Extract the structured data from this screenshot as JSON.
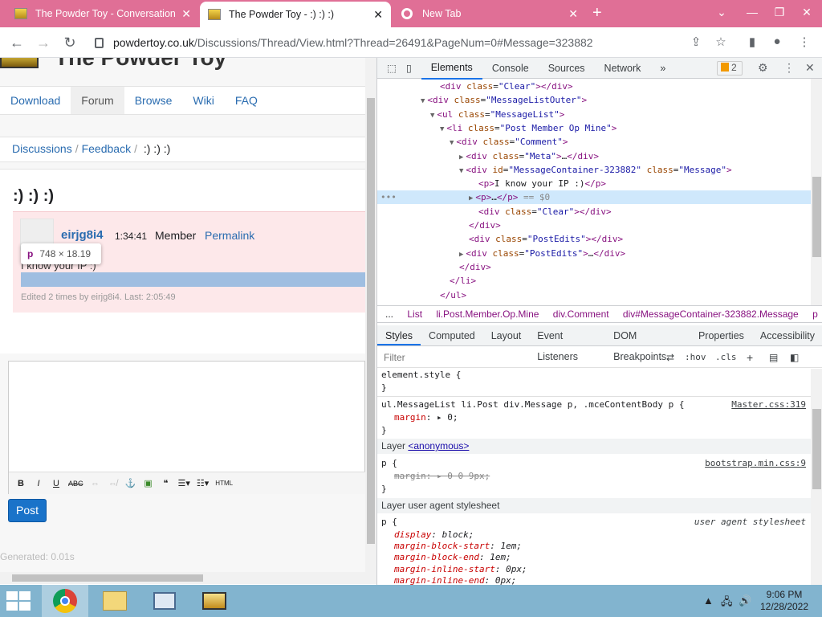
{
  "browser": {
    "tabs": [
      {
        "title": "The Powder Toy - Conversation",
        "icon": "powder-toy-favicon"
      },
      {
        "title": "The Powder Toy - :) :) :)",
        "icon": "powder-toy-favicon",
        "active": true
      },
      {
        "title": "New Tab",
        "icon": "chrome-icon"
      }
    ],
    "url_host": "powdertoy.co.uk",
    "url_path": "/Discussions/Thread/View.html?Thread=26491&PageNum=0#Message=323882"
  },
  "site": {
    "title": "The Powder Toy",
    "menu": [
      "Download",
      "Forum",
      "Browse",
      "Wiki",
      "FAQ"
    ],
    "menu_current": "Forum",
    "breadcrumb": [
      "Discussions",
      "Feedback",
      ":) :) :)"
    ],
    "thread_title": ":) :) :)",
    "post": {
      "author": "eirjg8i4",
      "time": "1:34:41",
      "rank": "Member",
      "permalink": "Permalink",
      "message": "I know your IP :)",
      "edits": "Edited 2 times by eirjg8i4. Last: 2:05:49"
    },
    "tooltip": {
      "tag": "p",
      "size": "748 × 18.19"
    },
    "editor_toolbar": [
      "B",
      "I",
      "U",
      "ABC",
      "⇔",
      "⇎",
      "⚓",
      "▣",
      "❝",
      "☰▾",
      "☷▾",
      "HTML"
    ],
    "post_button": "Post",
    "generated": "Generated: 0.01s"
  },
  "devtools": {
    "tabs": [
      "Elements",
      "Console",
      "Sources",
      "Network",
      "»"
    ],
    "active_tab": "Elements",
    "issues_count": "2",
    "dom_lines": [
      {
        "indent": 6,
        "arrow": "",
        "html": "<div class=\"Clear\"></div>"
      },
      {
        "indent": 5,
        "arrow": "▼",
        "html": "<div class=\"MessageListOuter\">"
      },
      {
        "indent": 6,
        "arrow": "▼",
        "html": "<ul class=\"MessageList\">"
      },
      {
        "indent": 7,
        "arrow": "▼",
        "html": "<li class=\"Post Member Op Mine\">"
      },
      {
        "indent": 8,
        "arrow": "▼",
        "html": "<div class=\"Comment\">"
      },
      {
        "indent": 9,
        "arrow": "▶",
        "html": "<div class=\"Meta\">…</div>"
      },
      {
        "indent": 9,
        "arrow": "▼",
        "html": "<div id=\"MessageContainer-323882\" class=\"Message\">"
      },
      {
        "indent": 10,
        "arrow": "",
        "html": "<p>I know your IP :)</p>"
      },
      {
        "indent": 10,
        "arrow": "▶",
        "html": "<p>…</p> == $0",
        "selected": true
      },
      {
        "indent": 10,
        "arrow": "",
        "html": "<div class=\"Clear\"></div>"
      },
      {
        "indent": 9,
        "arrow": "",
        "html": "</div>"
      },
      {
        "indent": 9,
        "arrow": "",
        "html": "<div class=\"PostEdits\"></div>"
      },
      {
        "indent": 9,
        "arrow": "▶",
        "html": "<div class=\"PostEdits\">…</div>"
      },
      {
        "indent": 8,
        "arrow": "",
        "html": "</div>"
      },
      {
        "indent": 7,
        "arrow": "",
        "html": "</li>"
      },
      {
        "indent": 6,
        "arrow": "",
        "html": "</ul>"
      }
    ],
    "breadcrumb": [
      "...",
      "List",
      "li.Post.Member.Op.Mine",
      "div.Comment",
      "div#MessageContainer-323882.Message",
      "p"
    ],
    "style_tabs": [
      "Styles",
      "Computed",
      "Layout",
      "Event Listeners",
      "DOM Breakpoints",
      "Properties",
      "Accessibility"
    ],
    "filter_placeholder": "Filter",
    "hov": ":hov",
    "cls": ".cls",
    "rules": {
      "element_style": "element.style {",
      "close": "}",
      "rule1_selector": "ul.MessageList li.Post div.Message p, .mceContentBody p {",
      "rule1_source": "Master.css:319",
      "rule1_prop": "margin",
      "rule1_val": "0;",
      "layer1_label": "Layer",
      "layer1_name": "<anonymous>",
      "rule2_selector": "p {",
      "rule2_source": "bootstrap.min.css:9",
      "rule2_prop": "margin",
      "rule2_val": "0 0 9px;",
      "layer2_label": "Layer user agent stylesheet",
      "rule3_selector": "p {",
      "rule3_source": "user agent stylesheet",
      "ua_props": [
        {
          "p": "display",
          "v": "block;"
        },
        {
          "p": "margin-block-start",
          "v": "1em;"
        },
        {
          "p": "margin-block-end",
          "v": "1em;"
        },
        {
          "p": "margin-inline-start",
          "v": "0px;"
        },
        {
          "p": "margin-inline-end",
          "v": "0px;"
        }
      ]
    }
  },
  "taskbar": {
    "time": "9:06 PM",
    "date": "12/28/2022"
  }
}
